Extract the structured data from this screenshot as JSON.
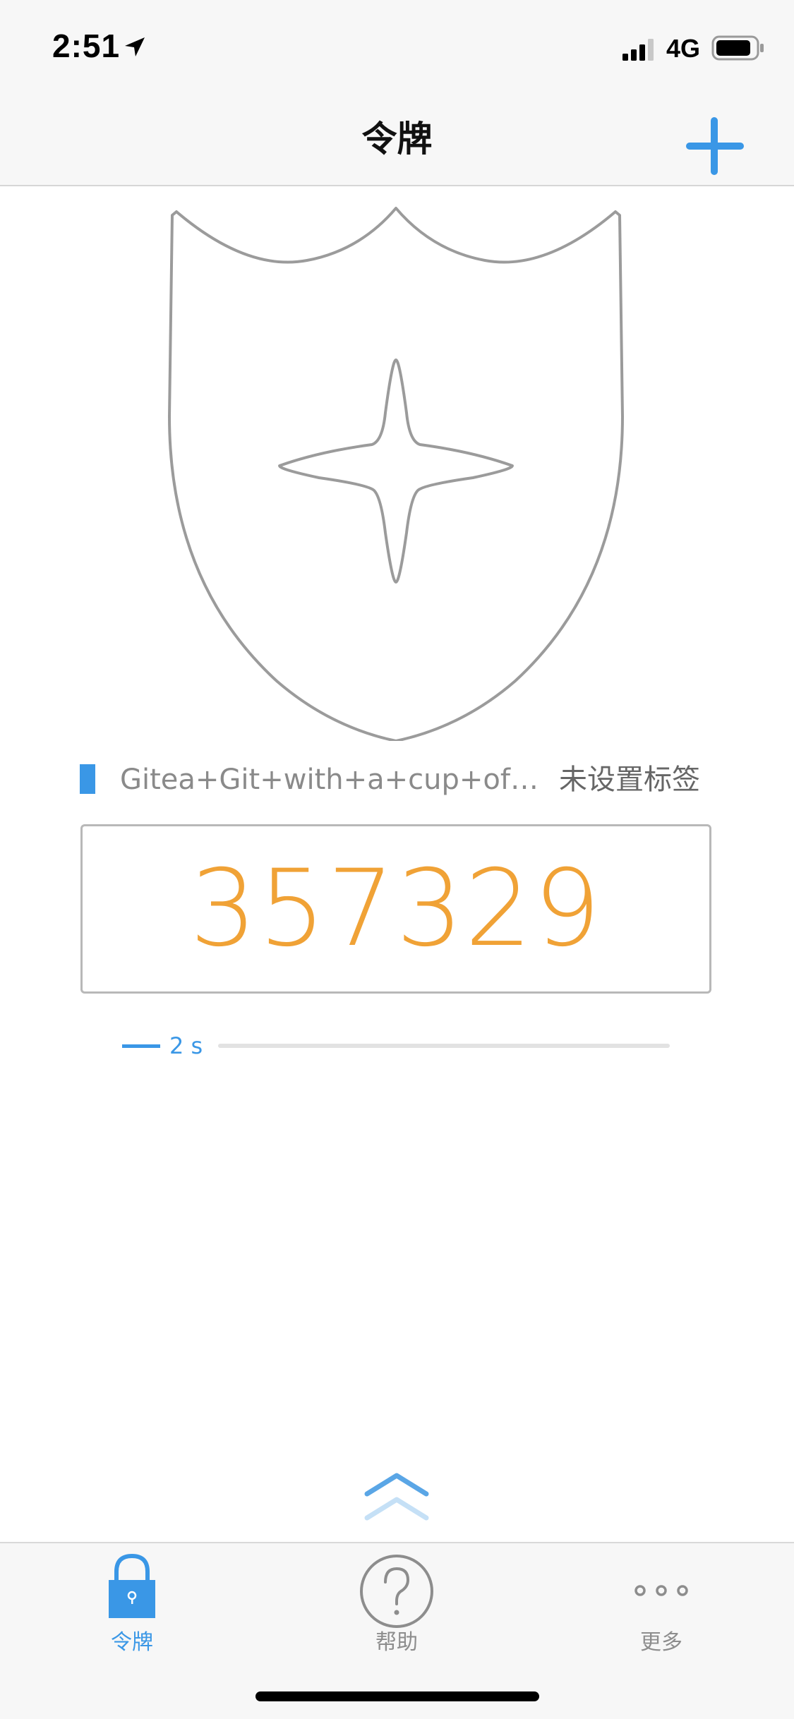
{
  "status_bar": {
    "time": "2:51",
    "network": "4G",
    "icons": [
      "location-arrow-icon",
      "cellular-signal-icon",
      "battery-icon"
    ]
  },
  "nav": {
    "title": "令牌",
    "add_icon": "plus-icon"
  },
  "token": {
    "issuer": "Gitea+Git+with+a+cup+of+te...",
    "tag": "未设置标签",
    "code": "357329",
    "countdown": "2 s",
    "countdown_remaining_fraction": 0.07,
    "illustration": "shield-icon"
  },
  "tabs": [
    {
      "label": "令牌",
      "icon": "padlock-icon",
      "active": true
    },
    {
      "label": "帮助",
      "icon": "question-circle-icon",
      "active": false
    },
    {
      "label": "更多",
      "icon": "more-dots-icon",
      "active": false
    }
  ],
  "colors": {
    "accent": "#3a97e6",
    "code": "#f0a236",
    "bar_background": "#f7f7f7",
    "inactive_tab": "#8d8d8d"
  }
}
